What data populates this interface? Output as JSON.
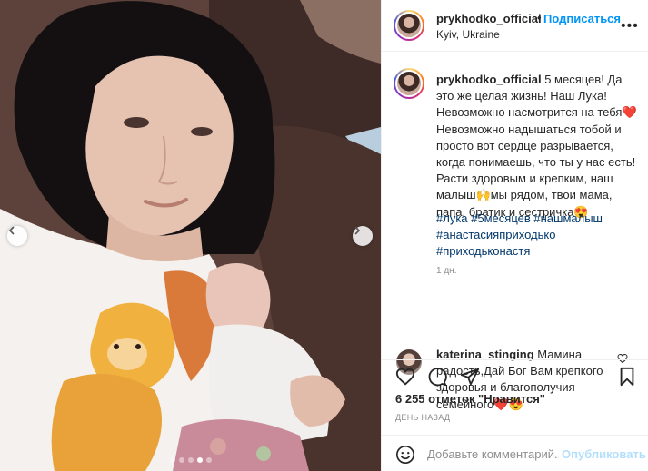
{
  "post": {
    "username": "prykhodko_official",
    "follow_label": "Подписаться",
    "separator": "•",
    "location": "Kyiv, Ukraine",
    "more_icon": "more-horizontal-icon"
  },
  "caption": {
    "username": "prykhodko_official",
    "text": "5 месяцев! Да это же целая жизнь! Наш Лука! Невозможно насмотрится на тебя❤️ Невозможно надышаться тобой и просто вот сердце разрывается, когда понимаешь, что ты у нас есть! Расти здоровым и крепким, наш малыш🙌мы рядом, твои мама, папа, братик и сестричка😍",
    "hashtags": [
      "#лука",
      "#5месяцев",
      "#нашмалыш",
      "#анастасияприходько",
      "#приходьконастя"
    ],
    "time": "1 дн."
  },
  "comment": {
    "username": "katerina_stinging",
    "text": "Мамина радость,Дай Бог Вам крепкого здоровья и благополучия семейного❤️😍",
    "like_icon": "heart-outline-icon"
  },
  "actions": {
    "like_icon": "heart-icon",
    "comment_icon": "comment-bubble-icon",
    "share_icon": "paper-plane-icon",
    "save_icon": "bookmark-icon"
  },
  "likes": {
    "text": "6 255 отметок \"Нравится\""
  },
  "date": {
    "text": "ДЕНЬ НАЗАД"
  },
  "add_comment": {
    "placeholder": "Добавьте комментарий...",
    "publish_label": "Опубликовать",
    "emoji_icon": "smiley-icon"
  },
  "carousel": {
    "total": 5,
    "active_index": 3,
    "prev_icon": "chevron-left-icon",
    "next_icon": "chevron-right-icon"
  },
  "colors": {
    "link_blue": "#0095f6",
    "hashtag": "#00376b",
    "muted": "#8e8e8e",
    "publish_disabled": "#b2dffc"
  }
}
